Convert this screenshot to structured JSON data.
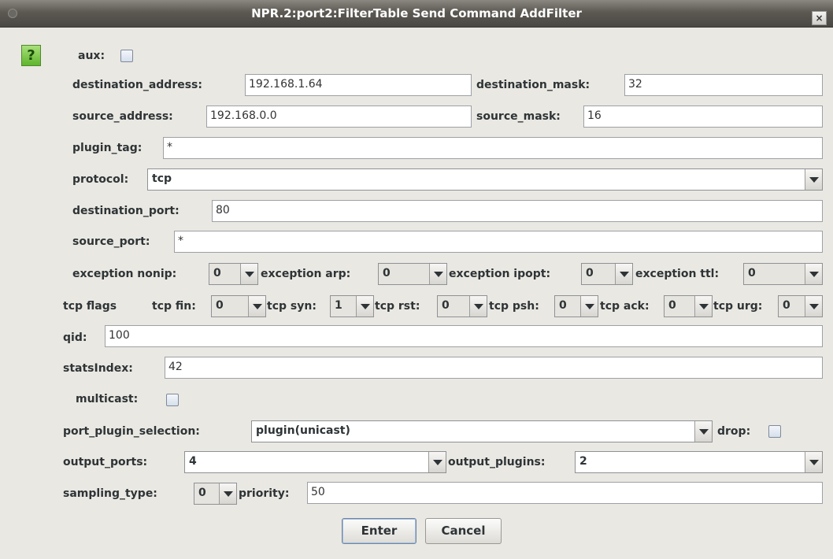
{
  "window": {
    "title": "NPR.2:port2:FilterTable Send Command AddFilter",
    "close_symbol": "×"
  },
  "help": {
    "symbol": "?"
  },
  "fields": {
    "aux": {
      "label": "aux:",
      "checked": false
    },
    "destination_address": {
      "label": "destination_address:",
      "value": "192.168.1.64"
    },
    "destination_mask": {
      "label": "destination_mask:",
      "value": "32"
    },
    "source_address": {
      "label": "source_address:",
      "value": "192.168.0.0"
    },
    "source_mask": {
      "label": "source_mask:",
      "value": "16"
    },
    "plugin_tag": {
      "label": "plugin_tag:",
      "value": "*"
    },
    "protocol": {
      "label": "protocol:",
      "value": "tcp"
    },
    "destination_port": {
      "label": "destination_port:",
      "value": "80"
    },
    "source_port": {
      "label": "source_port:",
      "value": "*"
    },
    "exception_nonip": {
      "label": "exception nonip:",
      "value": "0"
    },
    "exception_arp": {
      "label": "exception arp:",
      "value": "0"
    },
    "exception_ipopt": {
      "label": "exception ipopt:",
      "value": "0"
    },
    "exception_ttl": {
      "label": "exception ttl:",
      "value": "0"
    },
    "tcp_flags": {
      "label": "tcp flags"
    },
    "tcp_fin": {
      "label": "tcp fin:",
      "value": "0"
    },
    "tcp_syn": {
      "label": "tcp syn:",
      "value": "1"
    },
    "tcp_rst": {
      "label": "tcp rst:",
      "value": "0"
    },
    "tcp_psh": {
      "label": "tcp psh:",
      "value": "0"
    },
    "tcp_ack": {
      "label": "tcp ack:",
      "value": "0"
    },
    "tcp_urg": {
      "label": "tcp urg:",
      "value": "0"
    },
    "qid": {
      "label": "qid:",
      "value": "100"
    },
    "statsIndex": {
      "label": "statsIndex:",
      "value": "42"
    },
    "multicast": {
      "label": "multicast:",
      "checked": false
    },
    "port_plugin_selection": {
      "label": "port_plugin_selection:",
      "value": "plugin(unicast)"
    },
    "drop": {
      "label": "drop:",
      "checked": false
    },
    "output_ports": {
      "label": "output_ports:",
      "value": "4"
    },
    "output_plugins": {
      "label": "output_plugins:",
      "value": "2"
    },
    "sampling_type": {
      "label": "sampling_type:",
      "value": "0"
    },
    "priority": {
      "label": "priority:",
      "value": "50"
    }
  },
  "buttons": {
    "enter": "Enter",
    "cancel": "Cancel"
  },
  "colors": {
    "titlebar": "#5c5953",
    "dialog_bg": "#eae8e3",
    "help_green": "#5fb52c"
  }
}
